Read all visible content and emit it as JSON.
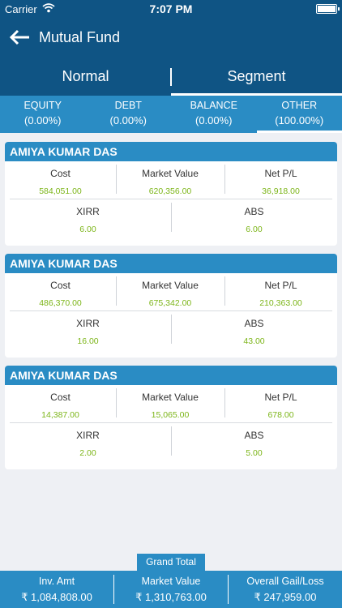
{
  "status_bar": {
    "carrier": "Carrier",
    "time": "7:07 PM"
  },
  "header": {
    "title": "Mutual Fund"
  },
  "mode_tabs": [
    {
      "label": "Normal",
      "active": false
    },
    {
      "label": "Segment",
      "active": true
    }
  ],
  "segment_tabs": [
    {
      "name": "EQUITY",
      "pct": "(0.00%)",
      "active": false
    },
    {
      "name": "DEBT",
      "pct": "(0.00%)",
      "active": false
    },
    {
      "name": "BALANCE",
      "pct": "(0.00%)",
      "active": false
    },
    {
      "name": "OTHER",
      "pct": "(100.00%)",
      "active": true
    }
  ],
  "labels": {
    "cost": "Cost",
    "market_value": "Market Value",
    "net_pl": "Net P/L",
    "xirr": "XIRR",
    "abs": "ABS"
  },
  "cards": [
    {
      "name": "AMIYA KUMAR DAS",
      "cost": "584,051.00",
      "market_value": "620,356.00",
      "net_pl": "36,918.00",
      "xirr": "6.00",
      "abs": "6.00"
    },
    {
      "name": "AMIYA KUMAR DAS",
      "cost": "486,370.00",
      "market_value": "675,342.00",
      "net_pl": "210,363.00",
      "xirr": "16.00",
      "abs": "43.00"
    },
    {
      "name": "AMIYA KUMAR DAS",
      "cost": "14,387.00",
      "market_value": "15,065.00",
      "net_pl": "678.00",
      "xirr": "2.00",
      "abs": "5.00"
    }
  ],
  "grand_total": {
    "label": "Grand Total",
    "inv_amt_label": "Inv. Amt",
    "inv_amt": "₹ 1,084,808.00",
    "market_value_label": "Market Value",
    "market_value": "₹ 1,310,763.00",
    "overall_label": "Overall Gail/Loss",
    "overall": "₹ 247,959.00"
  },
  "colors": {
    "primary_dark": "#0f5484",
    "primary": "#2a8cc4",
    "value_green": "#7cb518"
  }
}
